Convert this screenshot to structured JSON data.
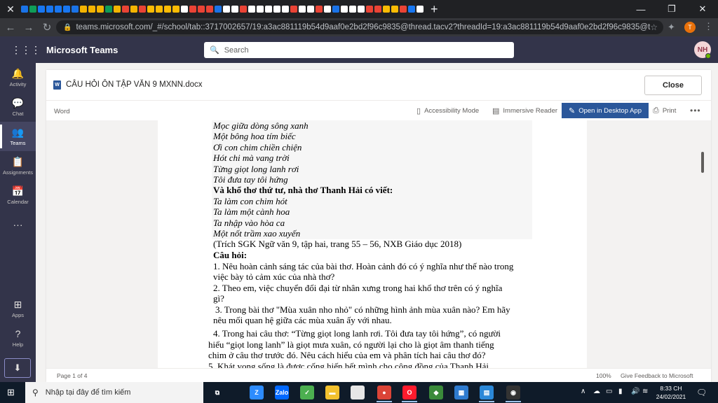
{
  "browser": {
    "url": "teams.microsoft.com/_#/school/tab::3717002657/19:a3ac881119b54d9aaf0e2bd2f96c9835@thread.tacv2?threadId=19:a3ac881119b54d9aaf0e2bd2f96c9835@thread.tacv2...",
    "profile_initial": "T",
    "tab_new_icon": "plus-icon",
    "favicon_colors": [
      "#1a73e8",
      "#0f9d58",
      "#1877f2",
      "#1877f2",
      "#1877f2",
      "#1877f2",
      "#1a73e8",
      "#f4b400",
      "#f4b400",
      "#f4b400",
      "#0f9d58",
      "#f4b400",
      "#ea4335",
      "#f4b400",
      "#ea4335",
      "#fbbc04",
      "#fbbc04",
      "#fbbc04",
      "#fbbc04",
      "#ffffff",
      "#ea4335",
      "#ea4335",
      "#ea4335",
      "#1a73e8",
      "#ffffff",
      "#ffffff",
      "#ea4335",
      "#ffffff",
      "#ffffff",
      "#ffffff",
      "#ffffff",
      "#ffffff",
      "#ea4335",
      "#ffffff",
      "#ffffff",
      "#ea4335",
      "#ffffff",
      "#1a73e8",
      "#ffffff",
      "#ffffff",
      "#ffffff",
      "#ea4335",
      "#ea4335",
      "#fbbc04",
      "#fbbc04",
      "#ea4335",
      "#1877f2",
      "#ffffff"
    ]
  },
  "teams": {
    "app_title": "Microsoft Teams",
    "search_placeholder": "Search",
    "user_initials": "NH",
    "rail": [
      {
        "id": "activity",
        "label": "Activity",
        "icon": "bell-icon",
        "glyph": "🔔"
      },
      {
        "id": "chat",
        "label": "Chat",
        "icon": "chat-icon",
        "glyph": "💬"
      },
      {
        "id": "teams",
        "label": "Teams",
        "icon": "teams-icon",
        "glyph": "👥",
        "active": true
      },
      {
        "id": "assignments",
        "label": "Assignments",
        "icon": "assignments-icon",
        "glyph": "📋"
      },
      {
        "id": "calendar",
        "label": "Calendar",
        "icon": "calendar-icon",
        "glyph": "📅"
      },
      {
        "id": "more",
        "label": "",
        "icon": "more-icon",
        "glyph": "···"
      },
      {
        "id": "apps",
        "label": "Apps",
        "icon": "apps-icon",
        "glyph": "⊞"
      },
      {
        "id": "help",
        "label": "Help",
        "icon": "help-icon",
        "glyph": "?"
      }
    ]
  },
  "document": {
    "filename": "CÂU HỎI ÔN TẬP VĂN 9 MXNN.docx",
    "close_label": "Close",
    "app_name": "Word",
    "ribbon": {
      "accessibility": "Accessibility Mode",
      "immersive": "Immersive Reader",
      "open_desktop": "Open in Desktop App",
      "print": "Print"
    },
    "status": {
      "page": "Page 1 of 4",
      "zoom": "100%",
      "feedback": "Give Feedback to Microsoft"
    },
    "lines": [
      "Mọc giữa dòng sông xanh",
      "Một bông hoa tím biếc",
      "Ơi con chim chiền chiện",
      "Hót chi mà vang trời",
      "Từng giọt long lanh rơi",
      "Tôi đưa tay tôi hứng",
      "Và khổ thơ thứ tư, nhà thơ Thanh Hải có viết:",
      "Ta làm con chim hót",
      "Ta làm một cành hoa",
      "Ta nhập vào hòa ca",
      "Một nốt trầm xao xuyến",
      "(Trích SGK Ngữ văn 9, tập hai, trang 55 – 56, NXB Giáo dục 2018)",
      "Câu hỏi:",
      "1. Nêu hoàn cảnh sáng tác của bài thơ. Hoàn cảnh đó có ý nghĩa như thế nào trong",
      "việc bày tỏ cảm xúc của nhà thơ?",
      "2. Theo em, việc chuyển đổi đại từ nhân xưng trong hai khổ thơ trên có ý nghĩa",
      "gì?",
      "3. Trong bài thơ \"Mùa xuân nho nhỏ\" có những hình ảnh mùa xuân nào? Em hãy",
      "nêu mối quan hệ giữa các mùa xuân ấy với nhau.",
      "4.  Trong hai câu thơ: “Từng giọt long lanh rơi. Tôi đưa tay tôi hứng”, có người",
      "hiểu “giọt long lanh” là giọt mưa xuân, có người lại cho là giọt âm thanh tiếng",
      "chim ở câu thơ trước đó. Nêu cách hiểu của em và phân tích hai câu thơ đó?",
      "5. Khát vọng sống là được cống hiến hết mình cho cộng đồng của Thanh Hải"
    ]
  },
  "taskbar": {
    "search_placeholder": "Nhập tại đây để tìm kiếm",
    "time": "8:33 CH",
    "date": "24/02/2021",
    "apps": [
      {
        "name": "task-view-icon",
        "color": "#0f1b29",
        "glyph": "⧉"
      },
      {
        "name": "zoom-icon",
        "color": "#2d8cff",
        "glyph": "Z"
      },
      {
        "name": "zalo-icon",
        "color": "#0068ff",
        "glyph": "Zalo"
      },
      {
        "name": "leaf-app-icon",
        "color": "#4caf50",
        "glyph": "✓"
      },
      {
        "name": "file-explorer-icon",
        "color": "#f2c12e",
        "glyph": "▬"
      },
      {
        "name": "blank-file-icon",
        "color": "#e6e6e6",
        "glyph": ""
      },
      {
        "name": "chrome-icon",
        "color": "#db4437",
        "glyph": "●"
      },
      {
        "name": "opera-icon",
        "color": "#ff1b2d",
        "glyph": "O"
      },
      {
        "name": "game-app-icon",
        "color": "#3a8a3a",
        "glyph": "◆"
      },
      {
        "name": "dashboard-app-icon",
        "color": "#2e7bcf",
        "glyph": "▦"
      },
      {
        "name": "photo-app-icon",
        "color": "#2b88d8",
        "glyph": "▤"
      },
      {
        "name": "media-app-icon",
        "color": "#333333",
        "glyph": "◉"
      }
    ]
  }
}
